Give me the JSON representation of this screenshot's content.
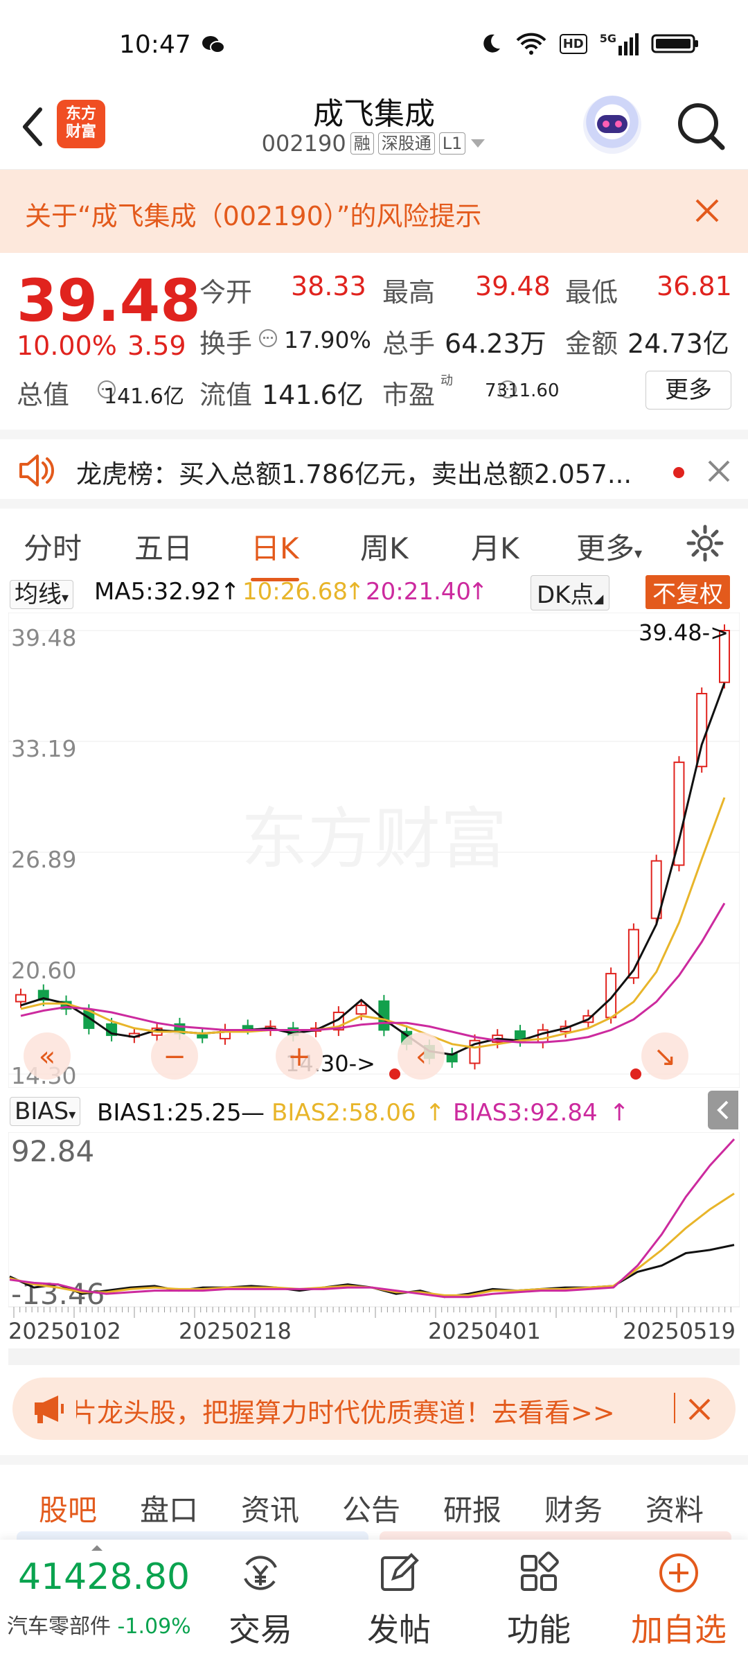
{
  "status": {
    "time": "10:47",
    "net": "5G",
    "hd": "HD"
  },
  "header": {
    "title": "成飞集成",
    "code": "002190",
    "tags": [
      "融",
      "深股通",
      "L1"
    ],
    "logo_text": "东方财富"
  },
  "risk": {
    "text": "关于“成飞集成（002190）”的风险提示"
  },
  "quote": {
    "price": "39.48",
    "change_pct": "10.00%",
    "change": "3.59",
    "open_label": "今开",
    "open": "38.33",
    "high_label": "最高",
    "high": "39.48",
    "low_label": "最低",
    "low": "36.81",
    "turnover_label": "换手",
    "turnover": "17.90%",
    "volume_label": "总手",
    "volume": "64.23万",
    "amount_label": "金额",
    "amount": "24.73亿",
    "mktcap_label": "总值",
    "mktcap": "141.6亿",
    "float_label": "流值",
    "float": "141.6亿",
    "pe_label": "市盈",
    "pe_sup": "动",
    "pe": "7311.60",
    "more": "更多"
  },
  "dragon": {
    "text": "龙虎榜：买入总额1.786亿元，卖出总额2.057..."
  },
  "ktabs": [
    "分时",
    "五日",
    "日K",
    "周K",
    "月K",
    "更多"
  ],
  "ma_row": {
    "select": "均线",
    "ma5": "MA5:32.92",
    "ma10": "10:26.68",
    "ma20": "20:21.40",
    "dk": "DK点",
    "adjust": "不复权"
  },
  "bias_row": {
    "select": "BIAS",
    "b1": "BIAS1:25.25",
    "b2": "BIAS2:58.06",
    "b3": "BIAS3:92.84"
  },
  "colors": {
    "ma5": "#111111",
    "ma10": "#e8b52a",
    "ma20": "#cc2a9e",
    "up": "#e0231e",
    "down": "#12a04c",
    "accent": "#e35a1c"
  },
  "watermark": "东方财富",
  "chart_data": [
    {
      "type": "candlestick",
      "title": "",
      "y_ticks": [
        "39.48",
        "33.19",
        "26.89",
        "20.60",
        "14.30"
      ],
      "ylim": [
        14.3,
        39.48
      ],
      "last_label": "39.48->",
      "min_label": "14.30->",
      "series": [
        {
          "name": "MA5",
          "values": [
            18.2,
            18.6,
            18.3,
            17.5,
            16.6,
            16.4,
            16.8,
            16.7,
            16.6,
            16.7,
            16.8,
            16.9,
            16.6,
            16.8,
            17.4,
            18.5,
            17.4,
            16.5,
            15.6,
            15.4,
            16.0,
            16.3,
            16.2,
            16.6,
            16.9,
            17.4,
            18.6,
            20.2,
            22.8,
            27.6,
            33.0,
            36.5
          ]
        },
        {
          "name": "MA10",
          "values": [
            18.0,
            18.3,
            18.3,
            17.9,
            17.3,
            16.9,
            16.7,
            16.7,
            16.6,
            16.7,
            16.7,
            16.8,
            16.8,
            16.8,
            17.0,
            17.6,
            17.4,
            17.0,
            16.5,
            16.0,
            15.8,
            16.0,
            16.2,
            16.3,
            16.6,
            16.9,
            17.5,
            18.4,
            20.1,
            22.9,
            26.5,
            30.0
          ]
        },
        {
          "name": "MA20",
          "values": [
            17.6,
            17.9,
            18.1,
            18.0,
            17.8,
            17.5,
            17.2,
            17.0,
            16.9,
            16.8,
            16.8,
            16.8,
            16.8,
            16.8,
            16.9,
            17.1,
            17.2,
            17.2,
            17.0,
            16.7,
            16.4,
            16.2,
            16.1,
            16.1,
            16.2,
            16.4,
            16.8,
            17.4,
            18.4,
            19.9,
            21.8,
            24.0
          ]
        }
      ],
      "candles_close": [
        18.8,
        18.5,
        18.0,
        16.9,
        16.5,
        16.6,
        16.9,
        16.6,
        16.4,
        16.8,
        16.9,
        17.0,
        16.5,
        16.9,
        17.8,
        18.2,
        16.8,
        16.0,
        15.2,
        15.0,
        16.2,
        16.5,
        16.2,
        16.8,
        17.0,
        17.6,
        20.0,
        22.5,
        26.4,
        32.0,
        35.9,
        39.48
      ]
    },
    {
      "type": "line",
      "title": "",
      "y_ticks": [
        "92.84",
        "-13.46"
      ],
      "ylim": [
        -13.46,
        92.84
      ],
      "x": [
        "20250102",
        "20250218",
        "20250401",
        "20250519"
      ],
      "series": [
        {
          "name": "BIAS1",
          "values": [
            5,
            -2,
            0,
            -6,
            -4,
            -2,
            -1,
            -4,
            -2,
            -2,
            -1,
            -2,
            -4,
            -2,
            0,
            -2,
            -6,
            -4,
            -8,
            -6,
            -3,
            -4,
            -3,
            -2,
            -2,
            -1,
            8,
            12,
            20,
            22,
            25.25
          ]
        },
        {
          "name": "BIAS2",
          "values": [
            4,
            0,
            -2,
            -5,
            -5,
            -3,
            -2,
            -3,
            -3,
            -2,
            -2,
            -2,
            -3,
            -2,
            -1,
            -2,
            -5,
            -5,
            -7,
            -7,
            -4,
            -4,
            -3,
            -3,
            -2,
            -1,
            10,
            22,
            36,
            48,
            58.06
          ]
        },
        {
          "name": "BIAS3",
          "values": [
            3,
            1,
            0,
            -4,
            -6,
            -5,
            -4,
            -4,
            -4,
            -3,
            -3,
            -3,
            -3,
            -3,
            -2,
            -2,
            -4,
            -6,
            -8,
            -8,
            -6,
            -5,
            -4,
            -4,
            -3,
            -2,
            12,
            32,
            56,
            76,
            92.84
          ]
        }
      ]
    }
  ],
  "banner": {
    "text": "芯片龙头股，把握算力时代优质赛道！去看看>>"
  },
  "gtabs": [
    "股吧",
    "盘口",
    "资讯",
    "公告",
    "研报",
    "财务",
    "资料"
  ],
  "bottom": {
    "index": "41428.80",
    "sector": "汽车零部件",
    "sector_chg": "-1.09%",
    "trade": "交易",
    "post": "发帖",
    "func": "功能",
    "add": "加自选"
  }
}
